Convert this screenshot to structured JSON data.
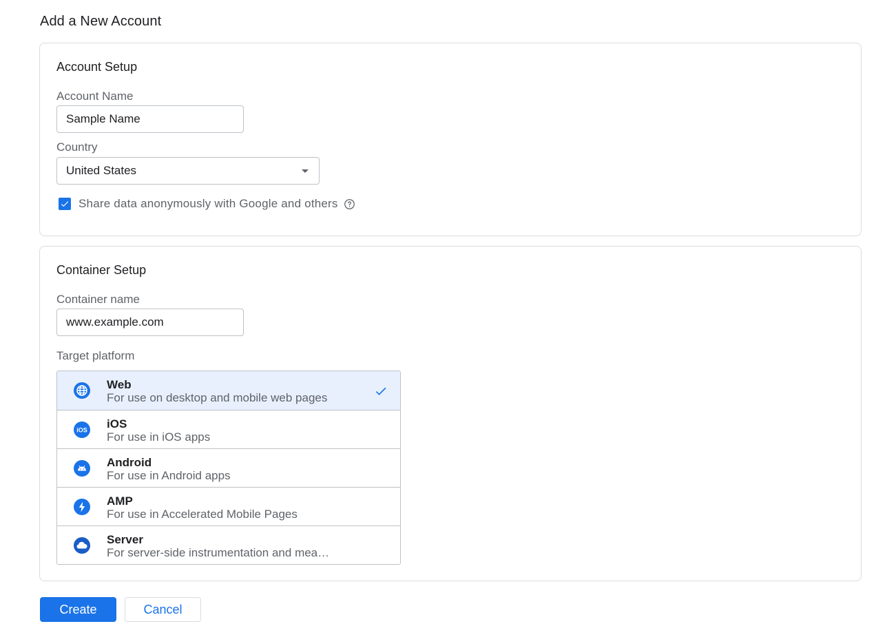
{
  "page": {
    "title": "Add a New Account"
  },
  "account_setup": {
    "title": "Account Setup",
    "account_name_label": "Account Name",
    "account_name_value": "Sample Name",
    "country_label": "Country",
    "country_value": "United States",
    "share_data_label": "Share data anonymously with Google and others",
    "share_data_checked": true
  },
  "container_setup": {
    "title": "Container Setup",
    "container_name_label": "Container name",
    "container_name_value": "www.example.com",
    "target_platform_label": "Target platform",
    "platforms": [
      {
        "name": "Web",
        "description": "For use on desktop and mobile web pages",
        "icon": "globe-icon",
        "selected": true
      },
      {
        "name": "iOS",
        "description": "For use in iOS apps",
        "icon": "ios-icon",
        "selected": false
      },
      {
        "name": "Android",
        "description": "For use in Android apps",
        "icon": "android-icon",
        "selected": false
      },
      {
        "name": "AMP",
        "description": "For use in Accelerated Mobile Pages",
        "icon": "lightning-icon",
        "selected": false
      },
      {
        "name": "Server",
        "description": "For server-side instrumentation and measurement",
        "icon": "cloud-icon",
        "selected": false
      }
    ]
  },
  "actions": {
    "create_label": "Create",
    "cancel_label": "Cancel"
  },
  "colors": {
    "accent": "#1a73e8",
    "selected_bg": "#e8f0fe",
    "border": "#dadce0",
    "muted_text": "#5f6368"
  }
}
